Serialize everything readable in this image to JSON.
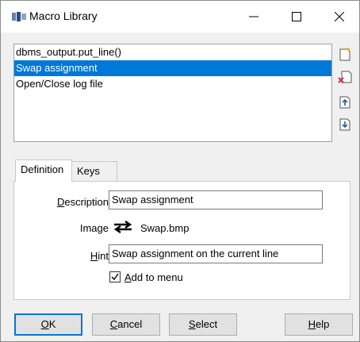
{
  "window": {
    "title": "Macro Library"
  },
  "macros": [
    {
      "label": "dbms_output.put_line()",
      "selected": false
    },
    {
      "label": "Swap assignment",
      "selected": true
    },
    {
      "label": "Open/Close log file",
      "selected": false
    }
  ],
  "tabs": [
    {
      "label": "Definition",
      "active": true
    },
    {
      "label": "Keys",
      "active": false
    }
  ],
  "definition": {
    "description_label_prefix": "",
    "description_label_u": "D",
    "description_label_rest": "escription",
    "description_value": "Swap assignment",
    "image_label": "Image",
    "image_icon": "swap-arrows-icon",
    "image_value": "Swap.bmp",
    "hint_label_u": "H",
    "hint_label_rest": "int",
    "hint_value": "Swap assignment on the current line",
    "add_to_menu_checked": true,
    "add_to_menu_u": "A",
    "add_to_menu_rest": "dd to menu"
  },
  "buttons": {
    "ok_u": "O",
    "ok_rest": "K",
    "cancel_u": "C",
    "cancel_rest": "ancel",
    "select_u": "S",
    "select_rest": "elect",
    "help_u": "H",
    "help_rest": "elp"
  },
  "colors": {
    "selection": "#0078d7",
    "default_button_border": "#0078d7"
  }
}
